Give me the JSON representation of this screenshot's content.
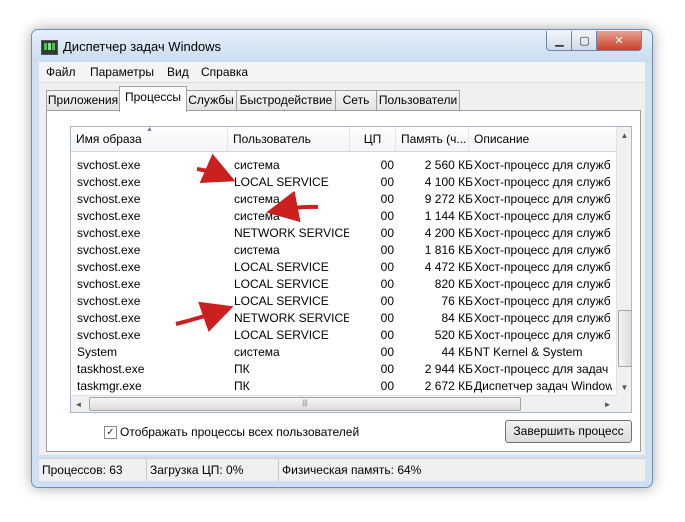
{
  "window": {
    "title": "Диспетчер задач Windows"
  },
  "menu": [
    "Файл",
    "Параметры",
    "Вид",
    "Справка"
  ],
  "tabs": [
    "Приложения",
    "Процессы",
    "Службы",
    "Быстродействие",
    "Сеть",
    "Пользователи"
  ],
  "active_tab": "Процессы",
  "columns": [
    "Имя образа",
    "Пользователь",
    "ЦП",
    "Память (ч...",
    "Описание"
  ],
  "processes": [
    {
      "name": "svchost.exe",
      "user": "система",
      "cpu": "00",
      "mem": "2 560 КБ",
      "desc": "Хост-процесс для служб W"
    },
    {
      "name": "svchost.exe",
      "user": "LOCAL SERVICE",
      "cpu": "00",
      "mem": "4 100 КБ",
      "desc": "Хост-процесс для служб W"
    },
    {
      "name": "svchost.exe",
      "user": "система",
      "cpu": "00",
      "mem": "9 272 КБ",
      "desc": "Хост-процесс для служб W"
    },
    {
      "name": "svchost.exe",
      "user": "система",
      "cpu": "00",
      "mem": "1 144 КБ",
      "desc": "Хост-процесс для служб W"
    },
    {
      "name": "svchost.exe",
      "user": "NETWORK SERVICE",
      "cpu": "00",
      "mem": "4 200 КБ",
      "desc": "Хост-процесс для служб W"
    },
    {
      "name": "svchost.exe",
      "user": "система",
      "cpu": "00",
      "mem": "1 816 КБ",
      "desc": "Хост-процесс для служб W"
    },
    {
      "name": "svchost.exe",
      "user": "LOCAL SERVICE",
      "cpu": "00",
      "mem": "4 472 КБ",
      "desc": "Хост-процесс для служб W"
    },
    {
      "name": "svchost.exe",
      "user": "LOCAL SERVICE",
      "cpu": "00",
      "mem": "820 КБ",
      "desc": "Хост-процесс для служб W"
    },
    {
      "name": "svchost.exe",
      "user": "LOCAL SERVICE",
      "cpu": "00",
      "mem": "76 КБ",
      "desc": "Хост-процесс для служб W"
    },
    {
      "name": "svchost.exe",
      "user": "NETWORK SERVICE",
      "cpu": "00",
      "mem": "84 КБ",
      "desc": "Хост-процесс для служб W"
    },
    {
      "name": "svchost.exe",
      "user": "LOCAL SERVICE",
      "cpu": "00",
      "mem": "520 КБ",
      "desc": "Хост-процесс для служб W"
    },
    {
      "name": "System",
      "user": "система",
      "cpu": "00",
      "mem": "44 КБ",
      "desc": "NT Kernel & System"
    },
    {
      "name": "taskhost.exe",
      "user": "ПК",
      "cpu": "00",
      "mem": "2 944 КБ",
      "desc": "Хост-процесс для задач W"
    },
    {
      "name": "taskmgr.exe",
      "user": "ПК",
      "cpu": "00",
      "mem": "2 672 КБ",
      "desc": "Диспетчер задач Windows"
    }
  ],
  "show_all_users": {
    "label": "Отображать процессы всех пользователей",
    "checked": true
  },
  "end_process_label": "Завершить процесс",
  "status": {
    "processes": "Процессов: 63",
    "cpu": "Загрузка ЦП: 0%",
    "memory": "Физическая память: 64%"
  },
  "annotation_color": "#cc1f1f"
}
